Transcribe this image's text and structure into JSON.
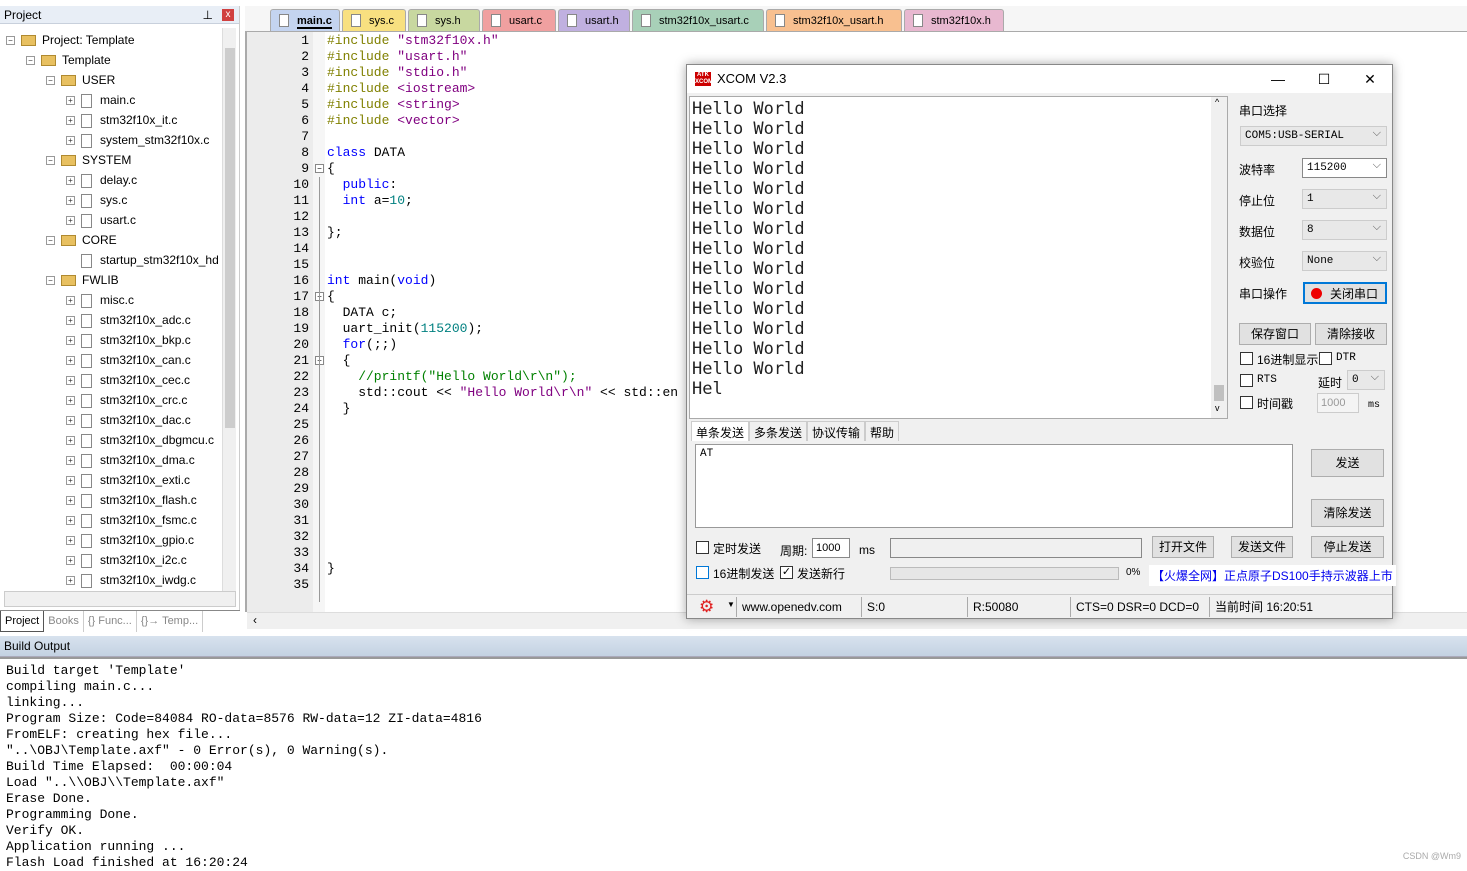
{
  "project": {
    "header": "Project",
    "tree": [
      {
        "label": "Project: Template",
        "level": 0,
        "type": "root",
        "exp": "-"
      },
      {
        "label": "Template",
        "level": 1,
        "type": "target",
        "exp": "-"
      },
      {
        "label": "USER",
        "level": 2,
        "type": "folder",
        "exp": "-"
      },
      {
        "label": "main.c",
        "level": 3,
        "type": "file",
        "exp": "+"
      },
      {
        "label": "stm32f10x_it.c",
        "level": 3,
        "type": "file",
        "exp": "+"
      },
      {
        "label": "system_stm32f10x.c",
        "level": 3,
        "type": "file",
        "exp": "+"
      },
      {
        "label": "SYSTEM",
        "level": 2,
        "type": "folder",
        "exp": "-"
      },
      {
        "label": "delay.c",
        "level": 3,
        "type": "file",
        "exp": "+"
      },
      {
        "label": "sys.c",
        "level": 3,
        "type": "file",
        "exp": "+"
      },
      {
        "label": "usart.c",
        "level": 3,
        "type": "file",
        "exp": "+"
      },
      {
        "label": "CORE",
        "level": 2,
        "type": "folder",
        "exp": "-"
      },
      {
        "label": "startup_stm32f10x_hd",
        "level": 3,
        "type": "file",
        "exp": ""
      },
      {
        "label": "FWLIB",
        "level": 2,
        "type": "folder",
        "exp": "-"
      },
      {
        "label": "misc.c",
        "level": 3,
        "type": "file",
        "exp": "+"
      },
      {
        "label": "stm32f10x_adc.c",
        "level": 3,
        "type": "file",
        "exp": "+"
      },
      {
        "label": "stm32f10x_bkp.c",
        "level": 3,
        "type": "file",
        "exp": "+"
      },
      {
        "label": "stm32f10x_can.c",
        "level": 3,
        "type": "file",
        "exp": "+"
      },
      {
        "label": "stm32f10x_cec.c",
        "level": 3,
        "type": "file",
        "exp": "+"
      },
      {
        "label": "stm32f10x_crc.c",
        "level": 3,
        "type": "file",
        "exp": "+"
      },
      {
        "label": "stm32f10x_dac.c",
        "level": 3,
        "type": "file",
        "exp": "+"
      },
      {
        "label": "stm32f10x_dbgmcu.c",
        "level": 3,
        "type": "file",
        "exp": "+"
      },
      {
        "label": "stm32f10x_dma.c",
        "level": 3,
        "type": "file",
        "exp": "+"
      },
      {
        "label": "stm32f10x_exti.c",
        "level": 3,
        "type": "file",
        "exp": "+"
      },
      {
        "label": "stm32f10x_flash.c",
        "level": 3,
        "type": "file",
        "exp": "+"
      },
      {
        "label": "stm32f10x_fsmc.c",
        "level": 3,
        "type": "file",
        "exp": "+"
      },
      {
        "label": "stm32f10x_gpio.c",
        "level": 3,
        "type": "file",
        "exp": "+"
      },
      {
        "label": "stm32f10x_i2c.c",
        "level": 3,
        "type": "file",
        "exp": "+"
      },
      {
        "label": "stm32f10x_iwdg.c",
        "level": 3,
        "type": "file",
        "exp": "+"
      }
    ],
    "bottom_tabs": [
      "Project",
      "Books",
      "{} Func...",
      "{}→ Temp..."
    ]
  },
  "tabs": [
    {
      "label": "main.c",
      "color": "#c4d4f0",
      "active": true
    },
    {
      "label": "sys.c",
      "color": "#f8e080"
    },
    {
      "label": "sys.h",
      "color": "#c8d8a0"
    },
    {
      "label": "usart.c",
      "color": "#f0a0a0"
    },
    {
      "label": "usart.h",
      "color": "#c0b0e0"
    },
    {
      "label": "stm32f10x_usart.c",
      "color": "#a8d0b8"
    },
    {
      "label": "stm32f10x_usart.h",
      "color": "#f8c090"
    },
    {
      "label": "stm32f10x.h",
      "color": "#e8b8d0"
    }
  ],
  "code": [
    [
      [
        "#include ",
        "pp"
      ],
      [
        "\"stm32f10x.h\"",
        "st"
      ]
    ],
    [
      [
        "#include ",
        "pp"
      ],
      [
        "\"usart.h\"",
        "st"
      ]
    ],
    [
      [
        "#include ",
        "pp"
      ],
      [
        "\"stdio.h\"",
        "st"
      ]
    ],
    [
      [
        "#include ",
        "pp"
      ],
      [
        "<iostream>",
        "st"
      ]
    ],
    [
      [
        "#include ",
        "pp"
      ],
      [
        "<string>",
        "st"
      ]
    ],
    [
      [
        "#include ",
        "pp"
      ],
      [
        "<vector>",
        "st"
      ]
    ],
    [],
    [
      [
        "class",
        "kw"
      ],
      [
        " DATA",
        "pl"
      ]
    ],
    [
      [
        "{",
        "pl"
      ]
    ],
    [
      [
        "  public",
        "kw"
      ],
      [
        ":",
        "pl"
      ]
    ],
    [
      [
        "  int",
        "kw"
      ],
      [
        " a=",
        "pl"
      ],
      [
        "10",
        "nm"
      ],
      [
        ";",
        "pl"
      ]
    ],
    [],
    [
      [
        "};",
        "pl"
      ]
    ],
    [],
    [],
    [
      [
        "int",
        "kw"
      ],
      [
        " main(",
        "pl"
      ],
      [
        "void",
        "kw"
      ],
      [
        ")",
        "pl"
      ]
    ],
    [
      [
        "{",
        "pl"
      ]
    ],
    [
      [
        "  DATA c;",
        "pl"
      ]
    ],
    [
      [
        "  uart_init(",
        "pl"
      ],
      [
        "115200",
        "nm"
      ],
      [
        ");",
        "pl"
      ]
    ],
    [
      [
        "  for",
        "kw"
      ],
      [
        "(;;)",
        "pl"
      ]
    ],
    [
      [
        "  {",
        "pl"
      ]
    ],
    [
      [
        "    //printf(\"Hello World\\r\\n\");",
        "cm"
      ]
    ],
    [
      [
        "    std::cout << ",
        "pl"
      ],
      [
        "\"Hello World\\r\\n\"",
        "st"
      ],
      [
        " << std::en",
        "pl"
      ]
    ],
    [
      [
        "  }",
        "pl"
      ]
    ],
    [],
    [],
    [],
    [],
    [],
    [],
    [],
    [],
    [],
    [
      [
        "}",
        "pl"
      ]
    ],
    []
  ],
  "build": {
    "header": "Build Output",
    "lines": [
      "Build target 'Template'",
      "compiling main.c...",
      "linking...",
      "Program Size: Code=84084 RO-data=8576 RW-data=12 ZI-data=4816",
      "FromELF: creating hex file...",
      "\"..\\OBJ\\Template.axf\" - 0 Error(s), 0 Warning(s).",
      "Build Time Elapsed:  00:00:04",
      "Load \"..\\\\OBJ\\\\Template.axf\"",
      "Erase Done.",
      "Programming Done.",
      "Verify OK.",
      "Application running ...",
      "Flash Load finished at 16:20:24"
    ]
  },
  "watermark": "CSDN @Wm9",
  "xcom": {
    "title": "XCOM V2.3",
    "logo": "ATK XCOM",
    "received": [
      "Hello World",
      "Hello World",
      "Hello World",
      "Hello World",
      "Hello World",
      "Hello World",
      "Hello World",
      "Hello World",
      "Hello World",
      "Hello World",
      "Hello World",
      "Hello World",
      "Hello World",
      "Hello World",
      "Hel"
    ],
    "port_label": "串口选择",
    "port": "COM5:USB-SERIAL",
    "baud_label": "波特率",
    "baud": "115200",
    "stop_label": "停止位",
    "stop": "1",
    "data_label": "数据位",
    "databits": "8",
    "parity_label": "校验位",
    "parity": "None",
    "op_label": "串口操作",
    "close_btn": "关闭串口",
    "save_btn": "保存窗口",
    "clear_recv_btn": "清除接收",
    "hex_show": "16进制显示",
    "dtr": "DTR",
    "rts": "RTS",
    "delay_label": "延时",
    "delay": "0",
    "timestamp": "时间戳",
    "ts_value": "1000",
    "ms": "ms",
    "send_tabs": [
      "单条发送",
      "多条发送",
      "协议传输",
      "帮助"
    ],
    "send_text": "AT",
    "send_btn": "发送",
    "clear_send_btn": "清除发送",
    "timed_send": "定时发送",
    "period_label": "周期:",
    "period": "1000",
    "period_ms": "ms",
    "open_file": "打开文件",
    "send_file": "发送文件",
    "stop_send": "停止发送",
    "hex_send": "16进制发送",
    "newline": "发送新行",
    "newline_checked": true,
    "progress": "0%",
    "ad": "【火爆全网】正点原子DS100手持示波器上市",
    "status": {
      "url": "www.openedv.com",
      "s": "S:0",
      "r": "R:50080",
      "lines": "CTS=0 DSR=0 DCD=0",
      "time": "当前时间 16:20:51"
    }
  }
}
